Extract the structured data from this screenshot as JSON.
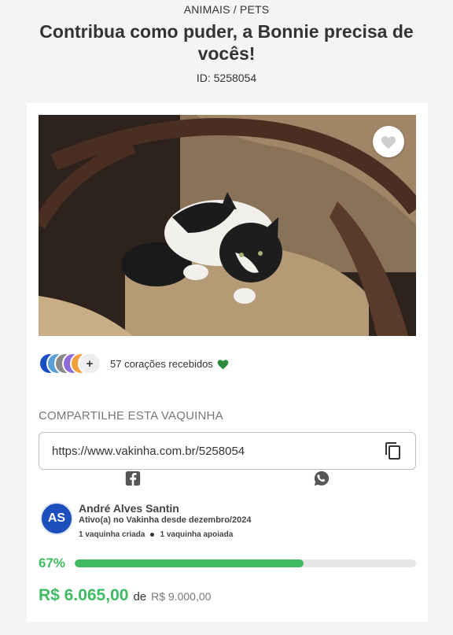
{
  "campaign": {
    "category": "ANIMAIS / PETS",
    "title": "Contribua como puder, a Bonnie precisa de vocês!",
    "id_label": "ID: 5258054"
  },
  "image": {
    "alt": "Gato preto e branco deitado em uma poltrona bege"
  },
  "favorite": {
    "icon": "heart-icon"
  },
  "supporters": {
    "more": "+",
    "hearts_text": "57 corações recebidos",
    "avatar_colors": [
      "#1a4fc4",
      "#5a9fd6",
      "#8a8a8a",
      "#8e6bd8",
      "#f2a03d"
    ],
    "heart_color": "#2e8b3e"
  },
  "share": {
    "title": "COMPARTILHE ESTA VAQUINHA",
    "url": "https://www.vakinha.com.br/5258054",
    "copy_icon": "copy-icon",
    "facebook_icon": "facebook-icon",
    "whatsapp_icon": "whatsapp-icon"
  },
  "creator": {
    "initials": "AS",
    "name": "André Alves Santin",
    "since": "Ativo(a) no Vakinha desde dezembro/2024",
    "created": "1 vaquinha criada",
    "supported": "1 vaquinha apoiada"
  },
  "progress": {
    "percent_label": "67%",
    "fraction": 0.67
  },
  "amounts": {
    "raised": "R$ 6.065,00",
    "of": "de",
    "goal": "R$ 9.000,00"
  },
  "colors": {
    "accent_green": "#3fbb62",
    "creator_blue": "#1b4fbd"
  }
}
